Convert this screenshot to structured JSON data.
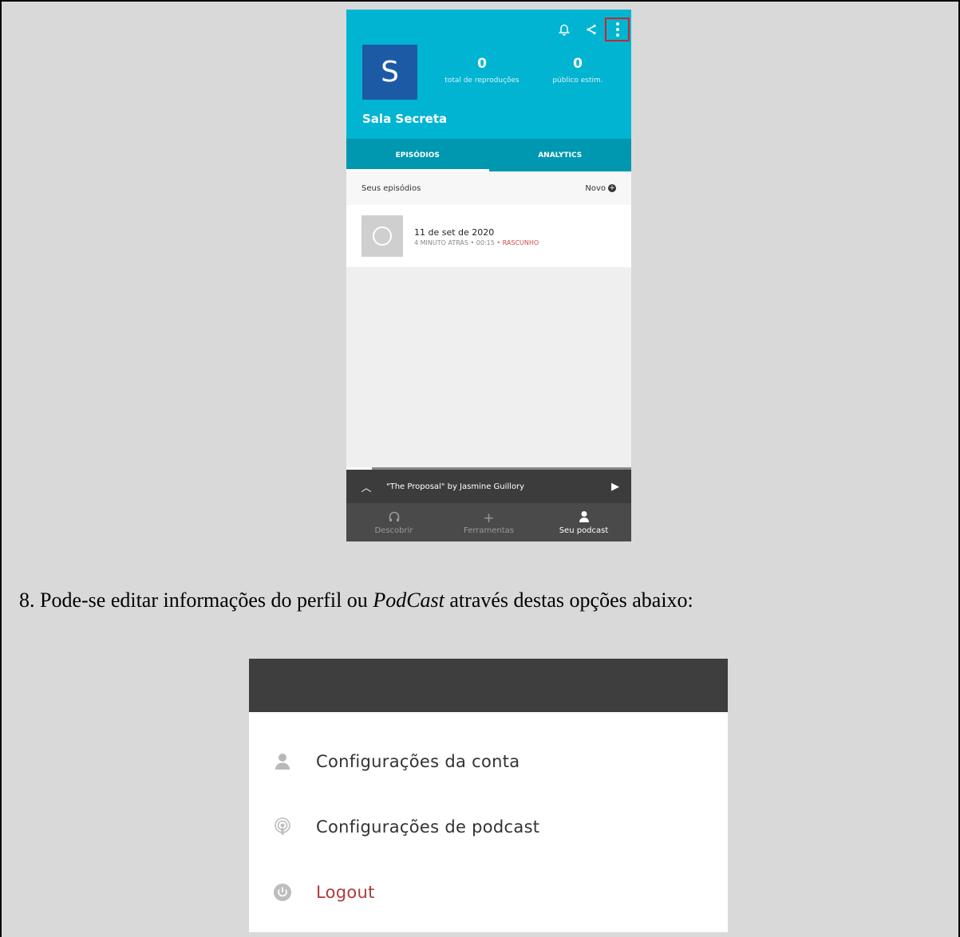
{
  "phone": {
    "avatar_letter": "S",
    "stats": [
      {
        "value": "0",
        "label": "total de reproduções"
      },
      {
        "value": "0",
        "label": "público estim."
      }
    ],
    "podcast_name": "Sala Secreta",
    "tabs": [
      "EPISÓDIOS",
      "ANALYTICS"
    ],
    "section_title": "Seus episódios",
    "new_label": "Novo",
    "episode": {
      "title": "11 de set de 2020",
      "meta": "4 MINUTO ATRÁS • 00:15 • ",
      "status": "RASCUNHO"
    },
    "player": {
      "track": "\"The Proposal\" by Jasmine Guillory"
    },
    "nav": [
      "Descobrir",
      "Ferramentas",
      "Seu podcast"
    ],
    "progress_fraction": 0.09
  },
  "paragraph": {
    "prefix": "8. Pode-se editar informações do perfil ou ",
    "emphasis": "PodCast",
    "suffix": " através destas opções abaixo:"
  },
  "menu": {
    "items": [
      {
        "label": "Configurações da conta",
        "icon": "person-icon"
      },
      {
        "label": "Configurações de podcast",
        "icon": "podcast-icon"
      },
      {
        "label": "Logout",
        "icon": "power-icon"
      }
    ],
    "logout_color": "#b23a3a"
  },
  "colors": {
    "header": "#00b4d2",
    "tabs": "#0097b0",
    "avatar": "#1c5aa6",
    "highlight": "#c62828"
  }
}
